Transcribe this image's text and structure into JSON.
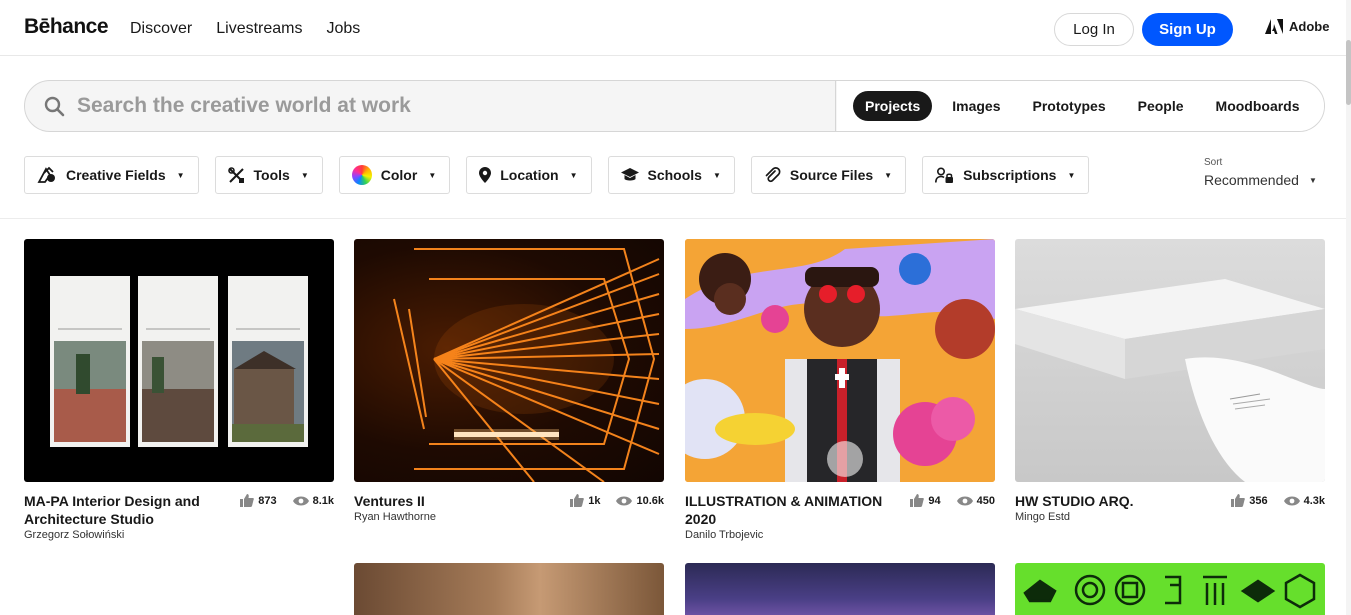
{
  "header": {
    "logo": "Bēhance",
    "nav": [
      "Discover",
      "Livestreams",
      "Jobs"
    ],
    "login_label": "Log In",
    "signup_label": "Sign Up",
    "adobe_label": "Adobe"
  },
  "search": {
    "placeholder": "Search the creative world at work",
    "tabs": [
      "Projects",
      "Images",
      "Prototypes",
      "People",
      "Moodboards"
    ],
    "active_tab": "Projects"
  },
  "filters": [
    "Creative Fields",
    "Tools",
    "Color",
    "Location",
    "Schools",
    "Source Files",
    "Subscriptions"
  ],
  "sort": {
    "label": "Sort",
    "value": "Recommended"
  },
  "projects": [
    {
      "title": "MA-PA Interior Design and Architecture Studio",
      "owner": "Grzegorz Sołowiński",
      "likes": "873",
      "views": "8.1k"
    },
    {
      "title": "Ventures II",
      "owner": "Ryan Hawthorne",
      "likes": "1k",
      "views": "10.6k"
    },
    {
      "title": "ILLUSTRATION & ANIMATION 2020",
      "owner": "Danilo Trbojevic",
      "likes": "94",
      "views": "450"
    },
    {
      "title": "HW STUDIO ARQ.",
      "owner": "Mingo Estd",
      "likes": "356",
      "views": "4.3k"
    }
  ],
  "colors": {
    "brand_blue": "#0057ff",
    "active_tab_bg": "#191919"
  }
}
